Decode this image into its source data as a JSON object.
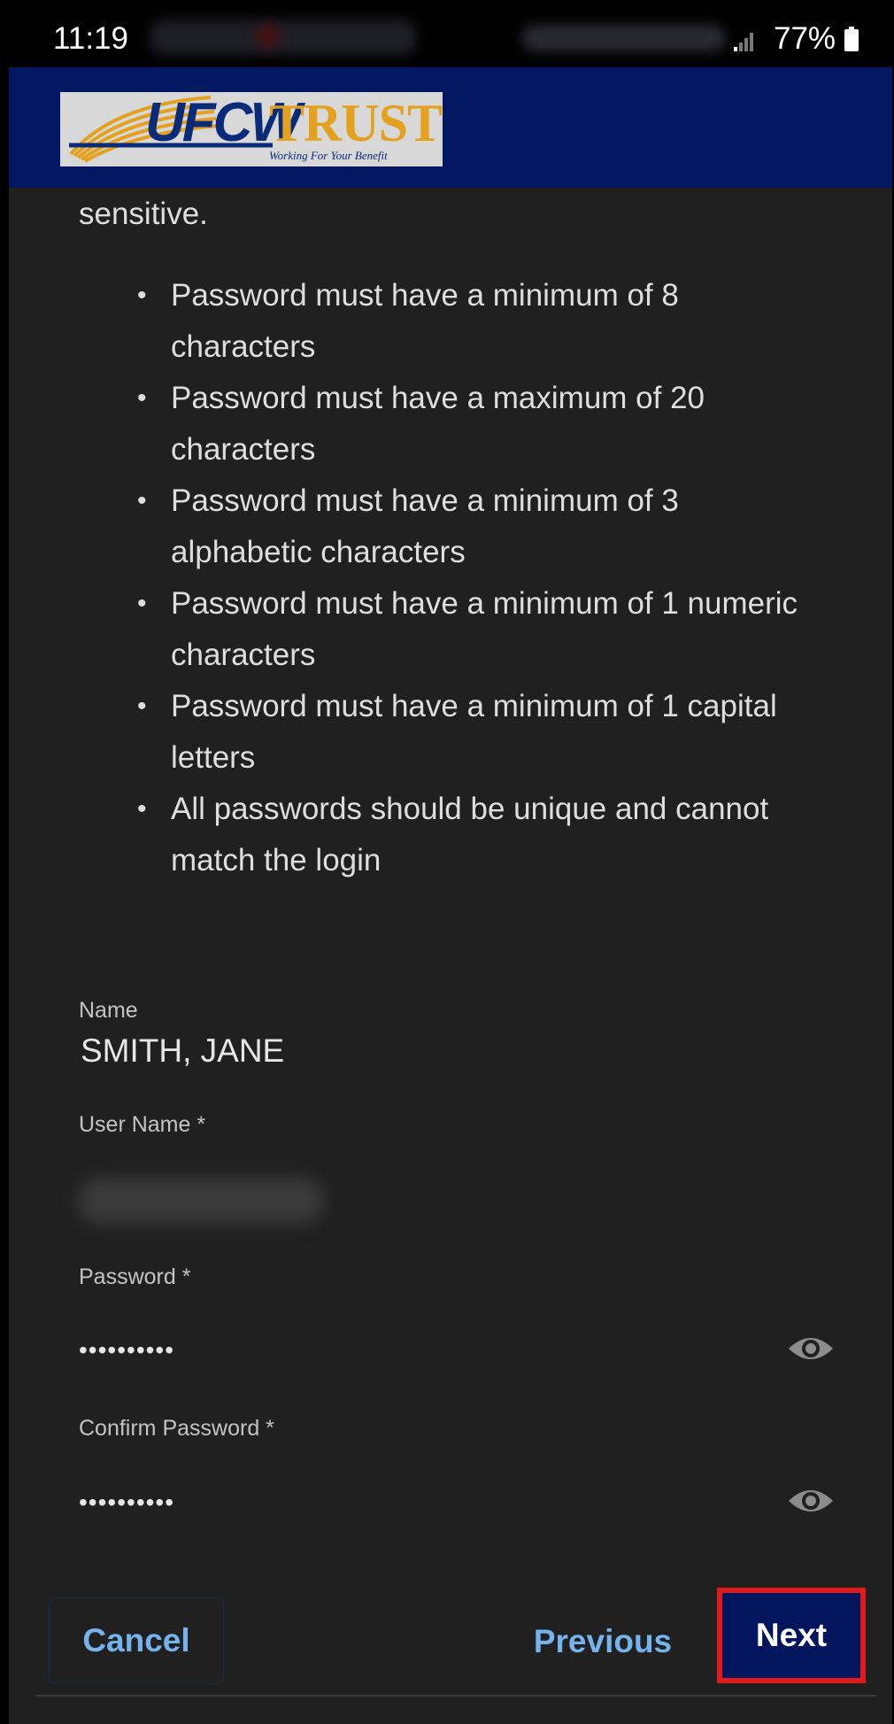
{
  "status_bar": {
    "time": "11:19",
    "battery_percent": "77%"
  },
  "header": {
    "logo_ufcw": "UFCW",
    "logo_trust": "TRUST",
    "logo_tagline": "Working For Your Benefit"
  },
  "intro_tail": "sensitive.",
  "password_rules": [
    "Password must have a minimum of 8 characters",
    "Password must have a maximum of 20 characters",
    "Password must have a minimum of 3 alphabetic characters",
    "Password must have a minimum of 1 numeric characters",
    "Password must have a minimum of 1 capital letters",
    "All passwords should be unique and cannot match the login"
  ],
  "form": {
    "name_label": "Name",
    "name_value": "SMITH, JANE",
    "username_label": "User Name *",
    "password_label": "Password *",
    "password_value": "••••••••••",
    "confirm_label": "Confirm Password *",
    "confirm_value": "••••••••••"
  },
  "buttons": {
    "cancel": "Cancel",
    "previous": "Previous",
    "next": "Next"
  }
}
